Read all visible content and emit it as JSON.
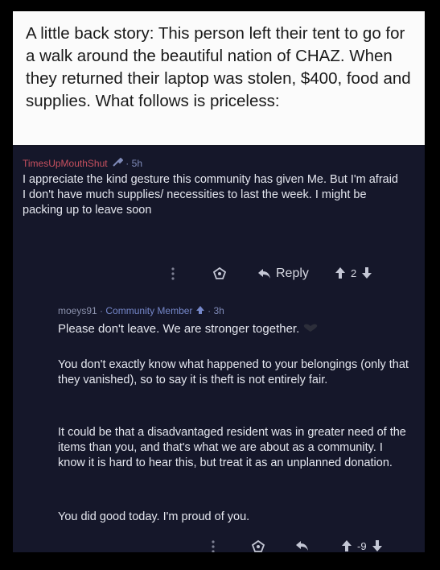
{
  "caption": {
    "text": "A little back story: This person left their tent to go for a walk around the beautiful nation of CHAZ. When they returned their laptop was stolen, $400, food and supplies. What follows is priceless:"
  },
  "post": {
    "username": "TimesUpMouthShut",
    "separator": "·",
    "age": "5h",
    "body": "I appreciate the kind gesture this community has given Me. But I'm afraid I don't have much supplies/ necessities to last the week. I might be packing up to leave soon",
    "reply_label": "Reply",
    "score": "2"
  },
  "reply": {
    "username": "moeys91",
    "separator1": "·",
    "flair": "Community Member",
    "separator2": "·",
    "age": "3h",
    "paragraphs": [
      "Please don't leave. We are stronger together.",
      "You don't exactly know what happened to your belongings (only that they vanished), so to say it is theft is not entirely fair.",
      "It could be that a disadvantaged resident was in greater need of the items than you, and that's what we are about as a community. I know it is hard to hear this, but treat it as an unplanned donation.",
      "You did good today. I'm proud of you."
    ],
    "score": "-9"
  },
  "colors": {
    "background": "#000000",
    "card": "#15172a",
    "username_red": "#c7505f",
    "flair_blue": "#7587c9"
  },
  "icons": [
    "wrench-icon",
    "more-options-icon",
    "award-icon",
    "reply-arrow-icon",
    "upvote-arrow-icon",
    "downvote-arrow-icon",
    "heart-icon"
  ]
}
